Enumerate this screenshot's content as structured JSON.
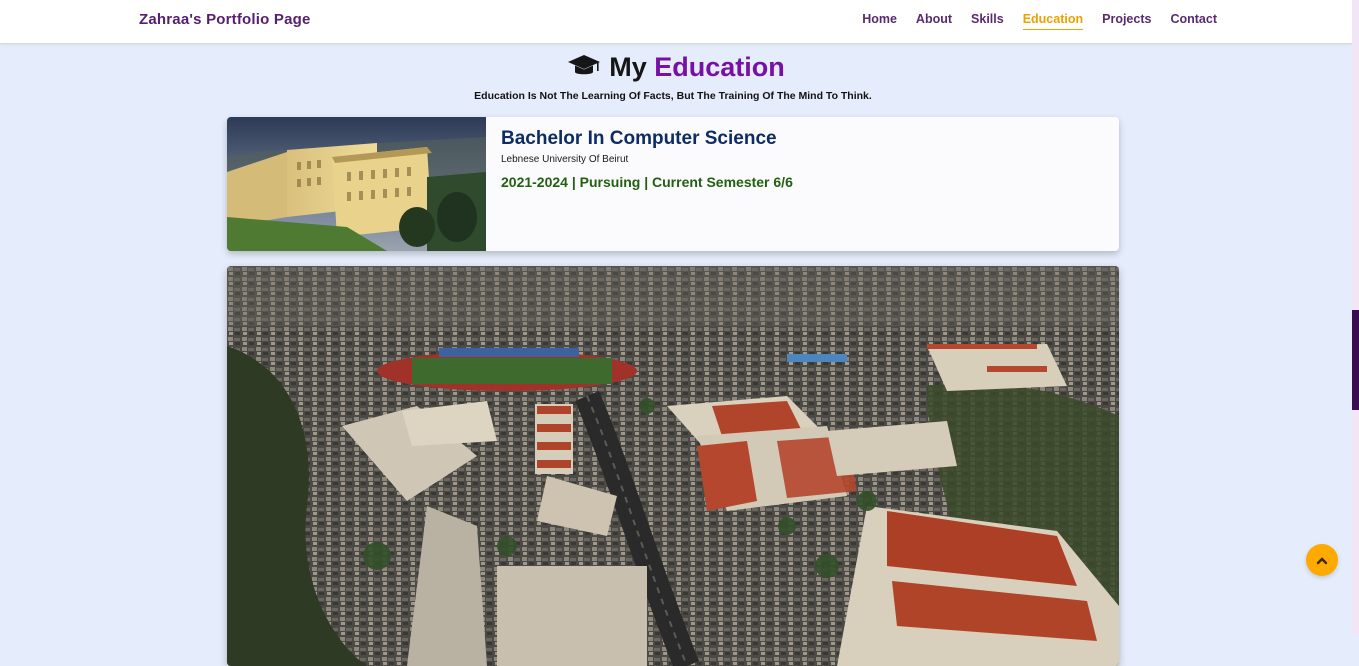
{
  "nav": {
    "brand": "Zahraa's Portfolio Page",
    "links": [
      {
        "label": "Home",
        "active": false
      },
      {
        "label": "About",
        "active": false
      },
      {
        "label": "Skills",
        "active": false
      },
      {
        "label": "Education",
        "active": true
      },
      {
        "label": "Projects",
        "active": false
      },
      {
        "label": "Contact",
        "active": false
      }
    ],
    "active_color": "#f0a000",
    "link_color": "#5a2a70"
  },
  "section": {
    "icon": "graduation-cap-icon",
    "title_prefix": "My",
    "title_accent": "Education",
    "accent_color": "#7710a4",
    "quote": "Education Is Not The Learning Of Facts, But The Training Of The Mind To Think."
  },
  "education": [
    {
      "degree": "Bachelor In Computer Science",
      "school": "Lebnese University Of Beirut",
      "years": "2021-2024 | Pursuing | Current Semester 6/6",
      "image": "university-building-photo"
    }
  ],
  "campus_photo": "aerial-campus-photo",
  "scroll_top": {
    "icon": "chevron-up-icon",
    "color": "#ffaa00"
  }
}
